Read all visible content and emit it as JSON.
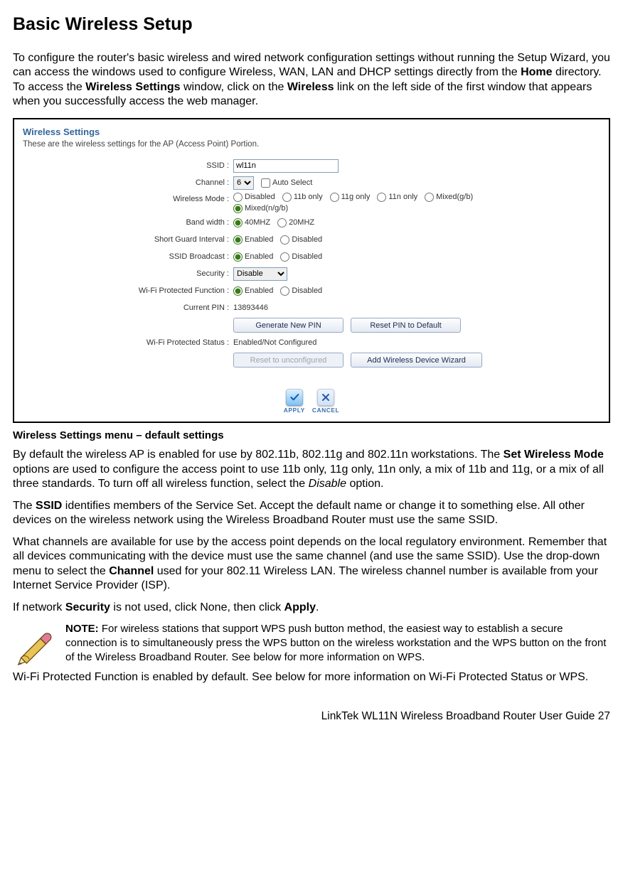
{
  "heading": "Basic Wireless Setup",
  "intro_parts": {
    "p1a": "To configure the router's basic wireless and wired network configuration settings without running the Setup Wizard, you can access the windows used to configure Wireless, WAN, LAN and DHCP settings directly from the ",
    "p1b": "Home",
    "p1c": " directory. To access the ",
    "p1d": "Wireless Settings",
    "p1e": " window, click on the ",
    "p1f": "Wireless",
    "p1g": " link on the left side of the first window that appears when you successfully access the web manager."
  },
  "panel": {
    "title": "Wireless Settings",
    "subtitle": "These are the wireless settings for the AP (Access Point) Portion.",
    "labels": {
      "ssid": "SSID :",
      "channel": "Channel :",
      "auto_select": "Auto Select",
      "wmode": "Wireless Mode :",
      "bandwidth": "Band width :",
      "sgi": "Short Guard Interval :",
      "ssidb": "SSID Broadcast :",
      "security": "Security :",
      "wpf": "Wi-Fi Protected Function :",
      "curpin": "Current PIN :",
      "wps_status": "Wi-Fi Protected Status :"
    },
    "values": {
      "ssid": "wl11n",
      "channel": "6",
      "wmode_disabled": "Disabled",
      "wmode_11b": "11b only",
      "wmode_11g": "11g only",
      "wmode_11n": "11n only",
      "wmode_mixgb": "Mixed(g/b)",
      "wmode_mixngb": "Mixed(n/g/b)",
      "bw40": "40MHZ",
      "bw20": "20MHZ",
      "enabled": "Enabled",
      "disabled": "Disabled",
      "security_sel": "Disable",
      "curpin": "13893446",
      "wps_status": "Enabled/Not Configured"
    },
    "buttons": {
      "gen_pin": "Generate New PIN",
      "reset_pin": "Reset PIN to Default",
      "reset_unconf": "Reset to unconfigured",
      "add_device": "Add Wireless Device Wizard",
      "apply": "APPLY",
      "cancel": "CANCEL"
    }
  },
  "caption": "Wireless Settings menu – default settings",
  "para2": {
    "a": "By default the wireless AP is enabled for use by 802.11b, 802.11g and 802.11n workstations. The ",
    "b": "Set Wireless Mode",
    "c": " options are used to configure the access point to use 11b only, 11g only, 11n only, a mix of 11b and 11g, or a mix of all three standards. To turn off all wireless function, select the ",
    "d": "Disable",
    "e": " option."
  },
  "para3": {
    "a": "The ",
    "b": "SSID",
    "c": " identifies members of the Service Set. Accept the default name or change it to something else. All other devices on the wireless network using the Wireless Broadband Router must use the same SSID."
  },
  "para4": {
    "a": "What channels are available for use by the access point depends on the local regulatory environment. Remember that all devices communicating with the device must use the same channel (and use the same SSID). Use the drop-down menu to select the ",
    "b": "Channel",
    "c": " used for your 802.11 Wireless LAN. The wireless channel number is available from your Internet Service Provider (ISP)."
  },
  "para5": {
    "a": "If network ",
    "b": "Security",
    "c": " is not used, click None, then click ",
    "d": "Apply",
    "e": "."
  },
  "note": {
    "label": "NOTE:",
    "text": " For wireless stations that support WPS push button method, the easiest way to establish a secure connection is to simultaneously press the WPS button on the wireless workstation and the WPS button on the front of the Wireless Broadband Router.  See below for more information on WPS."
  },
  "para6": "Wi-Fi Protected Function is enabled by default. See below for more information on Wi-Fi Protected Status or WPS.",
  "footer": {
    "text": "LinkTek WL11N Wireless Broadband Router User Guide",
    "page": "27"
  }
}
